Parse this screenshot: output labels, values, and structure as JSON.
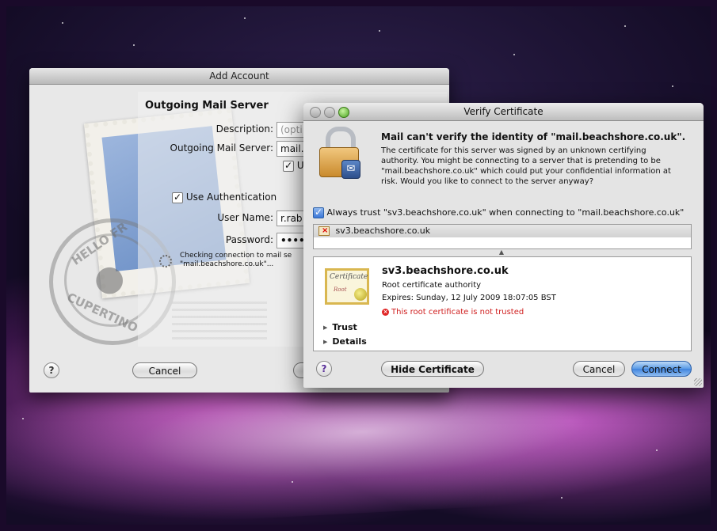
{
  "add_account": {
    "title": "Add Account",
    "section_title": "Outgoing Mail Server",
    "description_label": "Description:",
    "description_placeholder": "(opti",
    "server_label": "Outgoing Mail Server:",
    "server_value": "mail.",
    "use_checkbox_label": "U",
    "use_auth_label": "Use Authentication",
    "username_label": "User Name:",
    "username_value": "r.rab",
    "password_label": "Password:",
    "password_value": "••••",
    "status_line1": "Checking connection to mail se",
    "status_line2": "\"mail.beachshore.co.uk\"...",
    "help_label": "?",
    "cancel_label": "Cancel",
    "stamp_text_top": "HELLO FR",
    "stamp_text_bottom": "CUPERTINO"
  },
  "verify": {
    "title": "Verify Certificate",
    "headline": "Mail can't verify the identity of \"mail.beachshore.co.uk\".",
    "body": "The certificate for this server was signed by an unknown certifying authority. You might be connecting to a server that is pretending to be \"mail.beachshore.co.uk\" which could put your confidential information at risk. Would you like to connect to the server anyway?",
    "always_trust": "Always trust \"sv3.beachshore.co.uk\" when connecting to \"mail.beachshore.co.uk\"",
    "list_item": "sv3.beachshore.co.uk",
    "cert_name": "sv3.beachshore.co.uk",
    "cert_type": "Root certificate authority",
    "cert_expires": "Expires: Sunday, 12 July 2009 18:07:05 BST",
    "cert_warning": "This root certificate is not trusted",
    "cert_img_script": "Certificate",
    "cert_img_sub": "Root",
    "trust_label": "Trust",
    "details_label": "Details",
    "help_label": "?",
    "hide_cert_label": "Hide Certificate",
    "cancel_label": "Cancel",
    "connect_label": "Connect"
  }
}
